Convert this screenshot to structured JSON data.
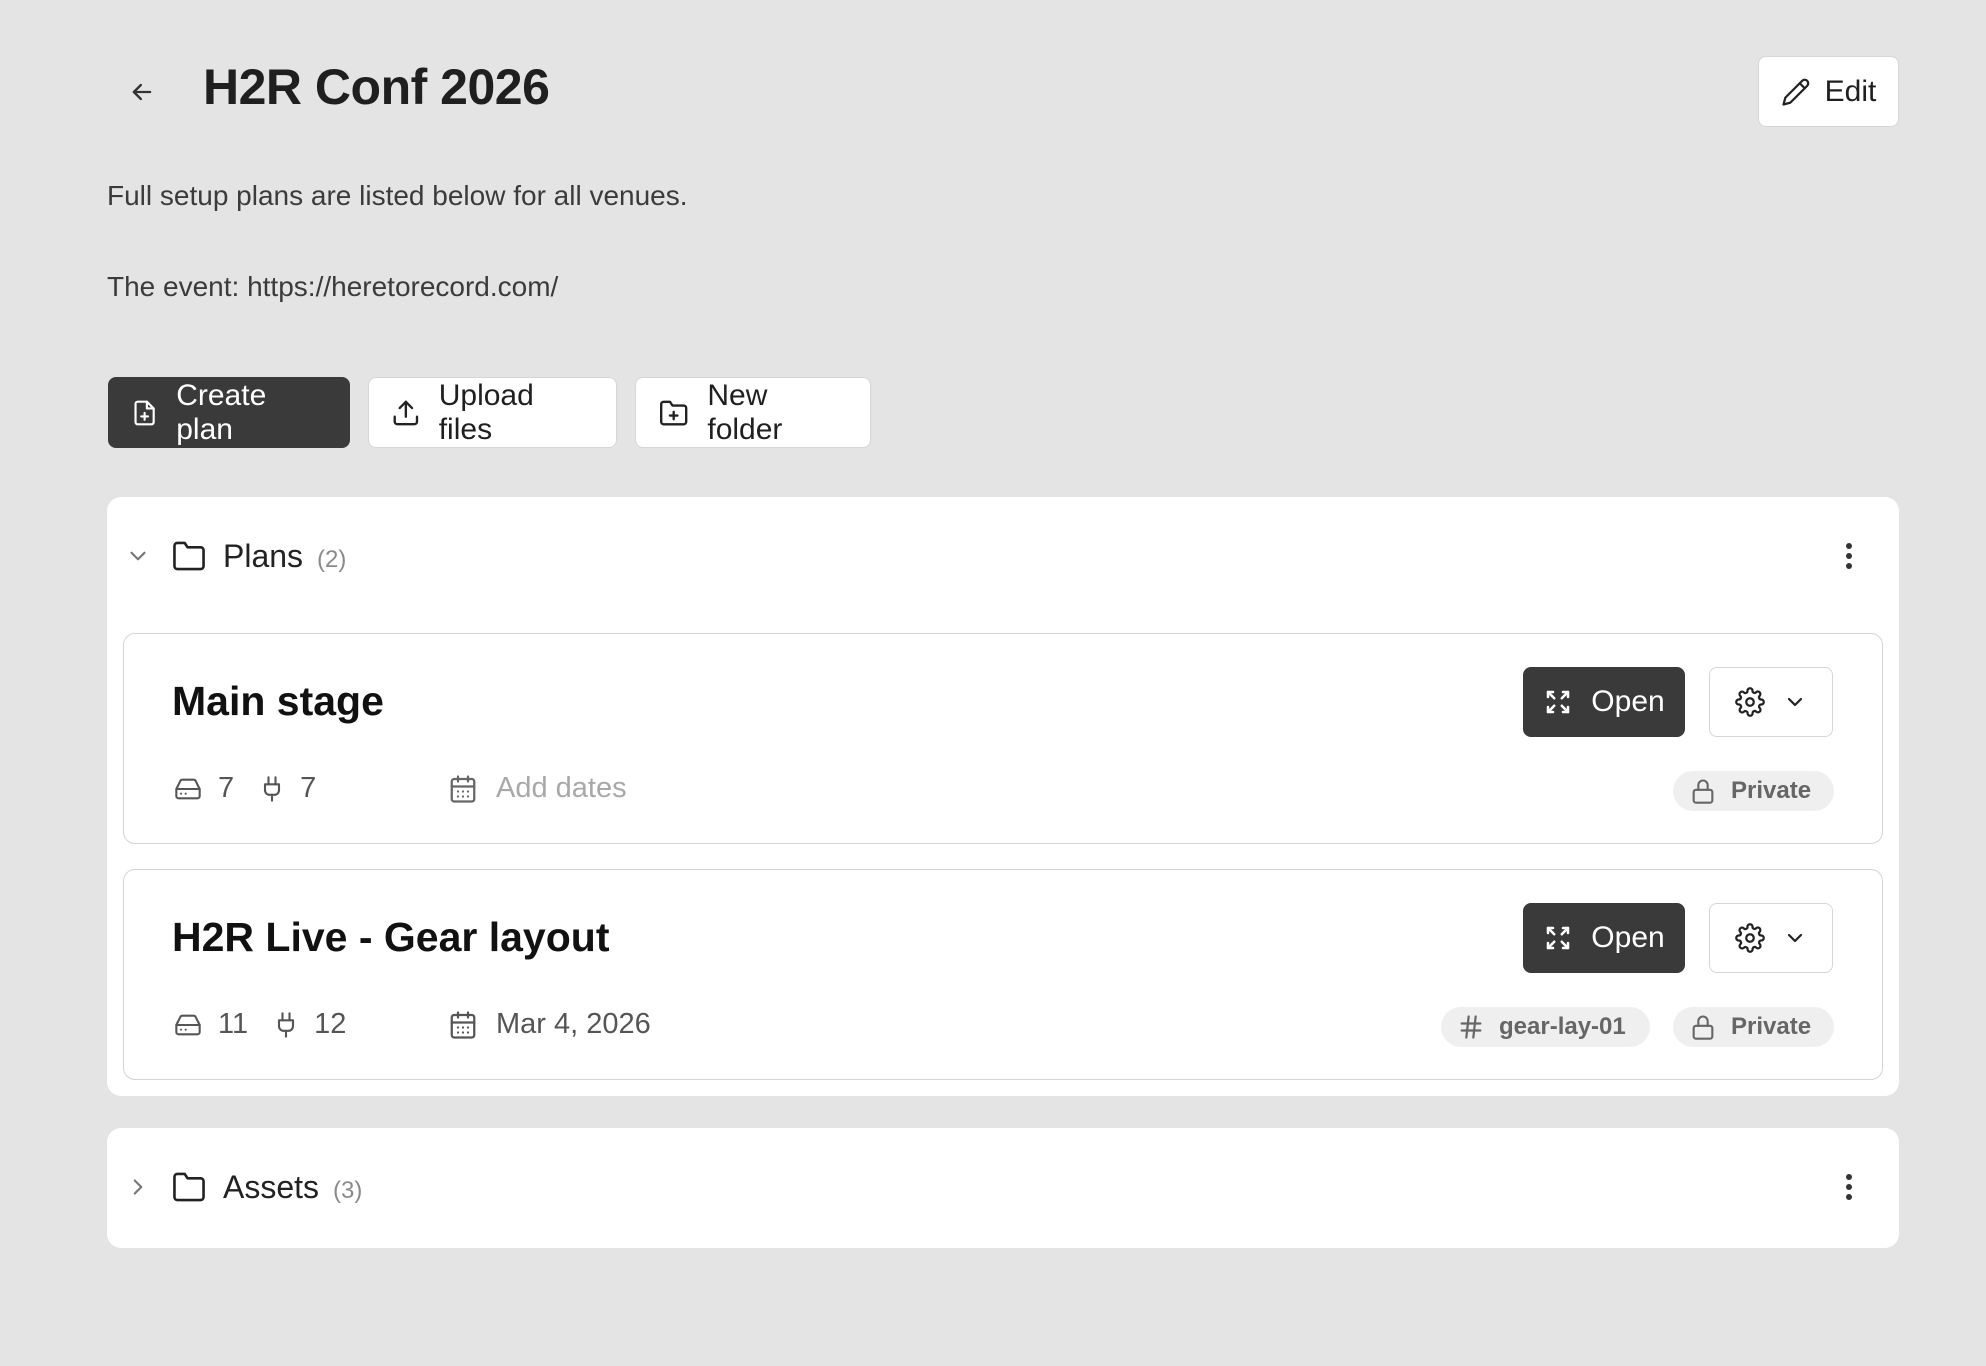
{
  "header": {
    "title": "H2R Conf 2026",
    "edit_label": "Edit"
  },
  "description": {
    "line1": "Full setup plans are listed below for all venues.",
    "line2": "The event: https://heretorecord.com/"
  },
  "toolbar": {
    "create_label": "Create plan",
    "upload_label": "Upload files",
    "folder_label": "New folder"
  },
  "folders": [
    {
      "name": "Plans",
      "count": "(2)",
      "expanded": true
    },
    {
      "name": "Assets",
      "count": "(3)",
      "expanded": false
    }
  ],
  "plans": [
    {
      "title": "Main stage",
      "open_label": "Open",
      "devices": "7",
      "connections": "7",
      "dates": "Add dates",
      "dates_set": false,
      "tag": null,
      "visibility": "Private"
    },
    {
      "title": "H2R Live - Gear layout",
      "open_label": "Open",
      "devices": "11",
      "connections": "12",
      "dates": "Mar 4, 2026",
      "dates_set": true,
      "tag": "gear-lay-01",
      "visibility": "Private"
    }
  ],
  "colors": {
    "background": "#e4e4e4",
    "primary_button": "#3a3a3a",
    "panel": "#ffffff"
  }
}
